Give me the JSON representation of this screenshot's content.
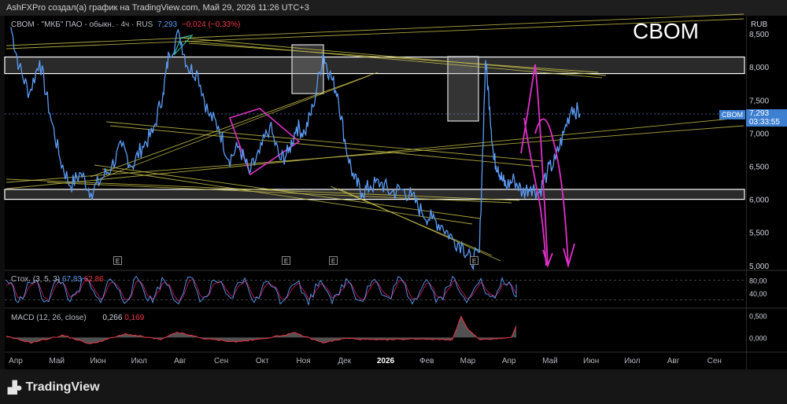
{
  "header": {
    "attribution": "AshFXPro создал(а) график на TradingView.com, Май 29, 2026 11:26 UTC+3"
  },
  "legend": {
    "symbol_info": "СВОМ · \"МКБ\" ПАО - обыкн. · 4ч · RUS",
    "last": "7,293",
    "change": "−0,024 (−0,33%)"
  },
  "watermark": "CBOM",
  "currency": "RUB",
  "price_tag": {
    "symbol": "CBOM",
    "price": "7,293",
    "countdown": "03:33:55"
  },
  "stoch_label": {
    "name": "Стох. (3, 5, 3)",
    "k": "67,83",
    "d": "62,86"
  },
  "macd_label": {
    "name": "MACD (12, 26, close)",
    "macd": "0,266",
    "signal": "0,169"
  },
  "earnings_marker": "E",
  "footer": {
    "brand": "TradingView"
  },
  "colors": {
    "price_line": "#5b9cf6",
    "trend_lines": "#c9c24a",
    "projection": "#e030c8",
    "zones": "#ffffff",
    "macd_line": "#f23645",
    "stoch_d": "#c2185b"
  },
  "chart_data": [
    {
      "type": "line",
      "title": "СВОМ · \"МКБ\" ПАО - обыкн. · 4ч · RUS",
      "ylabel": "RUB",
      "y_ticks": [
        "8,500",
        "8,000",
        "7,500",
        "7,000",
        "6,500",
        "6,000",
        "5,500",
        "5,000"
      ],
      "y_tick_values": [
        8.5,
        8.0,
        7.5,
        7.0,
        6.5,
        6.0,
        5.5,
        5.0
      ],
      "ylim": [
        4.95,
        8.75
      ],
      "x_ticks": [
        "Апр",
        "Май",
        "Июн",
        "Июл",
        "Авг",
        "Сен",
        "Окт",
        "Ноя",
        "Дек",
        "2026",
        "Фев",
        "Мар",
        "Апр",
        "Май",
        "Июн",
        "Июл",
        "Авг",
        "Сен"
      ],
      "x_tick_months": [
        0,
        1,
        2,
        3,
        4,
        5,
        6,
        7,
        8,
        9,
        10,
        11,
        12,
        13,
        14,
        15,
        16,
        17
      ],
      "xlim_months": [
        0,
        18
      ],
      "series": [
        {
          "x_months": [
            0.15,
            0.35,
            0.6,
            0.85,
            1.1,
            1.35,
            1.6,
            1.85,
            2.1,
            2.35,
            2.6,
            2.85,
            3.1,
            3.35,
            3.6,
            3.85,
            4.0,
            4.25,
            4.45,
            4.7,
            4.95,
            5.2,
            5.45,
            5.7,
            5.95,
            6.2,
            6.45,
            6.7,
            6.9,
            7.1,
            7.3,
            7.5,
            7.75,
            7.9,
            8.1,
            8.3,
            8.5,
            8.7,
            8.9,
            9.15,
            9.4,
            9.65,
            9.9,
            10.15,
            10.4,
            10.65,
            10.9,
            11.15,
            11.35,
            11.55,
            11.7,
            11.8,
            11.9,
            12.0,
            12.1,
            12.2,
            12.4,
            12.6,
            12.8,
            13.0,
            13.2,
            13.4,
            13.6,
            13.8,
            14.0
          ],
          "values": [
            8.6,
            8.0,
            7.6,
            8.1,
            7.3,
            6.6,
            6.2,
            6.4,
            6.1,
            6.3,
            6.5,
            6.8,
            6.5,
            6.8,
            7.0,
            7.6,
            8.2,
            8.5,
            8.0,
            7.9,
            7.3,
            7.1,
            6.6,
            6.8,
            6.4,
            6.7,
            7.1,
            6.6,
            6.7,
            7.1,
            7.0,
            7.4,
            8.2,
            7.9,
            7.6,
            6.8,
            6.3,
            6.1,
            6.2,
            6.25,
            6.1,
            6.15,
            6.05,
            5.8,
            5.7,
            5.6,
            5.4,
            5.3,
            5.05,
            5.2,
            8.1,
            7.4,
            6.6,
            6.5,
            6.3,
            6.2,
            6.3,
            6.1,
            6.2,
            6.1,
            6.4,
            6.6,
            7.0,
            7.4,
            7.29
          ]
        }
      ],
      "zones": [
        [
          7.9,
          8.15
        ],
        [
          6.0,
          6.15
        ]
      ],
      "annotations": [
        "E",
        "E",
        "E",
        "E"
      ],
      "legend": "none",
      "grid": false
    },
    {
      "type": "line",
      "title": "Стох. (3, 5, 3)",
      "y_ticks": [
        "80,00",
        "40,00"
      ],
      "y_tick_values": [
        80,
        40
      ],
      "ylim": [
        0,
        100
      ],
      "series": [
        {
          "name": "67,83",
          "last": 67.83
        },
        {
          "name": "62,86",
          "last": 62.86
        }
      ],
      "grid": false
    },
    {
      "type": "area",
      "title": "MACD (12, 26, close)",
      "y_ticks": [
        "0,500",
        "0,000"
      ],
      "y_tick_values": [
        0.5,
        0.0
      ],
      "ylim": [
        -0.3,
        0.6
      ],
      "series": [
        {
          "name": "0,266",
          "last": 0.266
        },
        {
          "name": "0,169",
          "last": 0.169
        }
      ],
      "grid": false
    }
  ]
}
